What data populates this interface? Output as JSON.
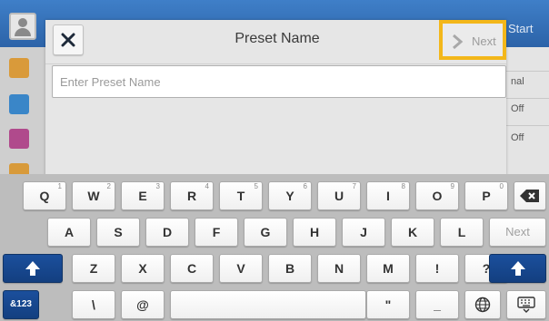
{
  "background": {
    "start_label": "Start",
    "right_labels": [
      "nal",
      "Off",
      "Off"
    ]
  },
  "dialog": {
    "title": "Preset Name",
    "next_label": "Next",
    "input_placeholder": "Enter Preset Name",
    "input_value": ""
  },
  "keyboard": {
    "row1": [
      {
        "key": "Q",
        "num": "1"
      },
      {
        "key": "W",
        "num": "2"
      },
      {
        "key": "E",
        "num": "3"
      },
      {
        "key": "R",
        "num": "4"
      },
      {
        "key": "T",
        "num": "5"
      },
      {
        "key": "Y",
        "num": "6"
      },
      {
        "key": "U",
        "num": "7"
      },
      {
        "key": "I",
        "num": "8"
      },
      {
        "key": "O",
        "num": "9"
      },
      {
        "key": "P",
        "num": "0"
      }
    ],
    "row2": [
      "A",
      "S",
      "D",
      "F",
      "G",
      "H",
      "J",
      "K",
      "L"
    ],
    "row2_next": "Next",
    "row3": [
      "Z",
      "X",
      "C",
      "V",
      "B",
      "N",
      "M",
      "!",
      "?"
    ],
    "row4": {
      "mode": "&123",
      "backslash": "\\",
      "at": "@",
      "quote": "\"",
      "underscore": "_"
    },
    "icons": {
      "backspace": "backspace-icon",
      "shift": "shift-arrow-icon",
      "globe": "globe-icon",
      "hide": "keyboard-hide-icon"
    }
  },
  "colors": {
    "topbar": "#2c63a8",
    "highlight": "#f3b71a",
    "shift_key": "#133f80"
  }
}
